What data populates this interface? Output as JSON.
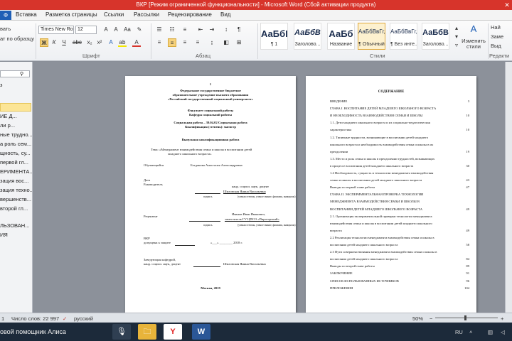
{
  "titlebar": {
    "title": "ВКР [Режим ограниченной функциональности] - Microsoft Word (Сбой активации продукта)",
    "close": "✕",
    "bg": "#d7342b"
  },
  "tabs": {
    "file": "Ф",
    "items": [
      "Вставка",
      "Разметка страницы",
      "Ссылки",
      "Рассылки",
      "Рецензирование",
      "Вид"
    ]
  },
  "ribbon": {
    "clipboard": {
      "label1": "вать",
      "label2": "ат по образцу"
    },
    "font": {
      "name": "Times New Ro",
      "size": "12",
      "group": "Шрифт"
    },
    "paragraph": {
      "group": "Абзац"
    },
    "styles": [
      {
        "sample": "АаБбI",
        "name": "¶ 1"
      },
      {
        "sample": "АаБбВ",
        "name": "Заголово..."
      },
      {
        "sample": "АаБб",
        "name": "Название"
      },
      {
        "sample": "АаБбВвГг,",
        "name": "¶ Обычный"
      },
      {
        "sample": "АаБбВвГг,",
        "name": "¶ Без инте..."
      },
      {
        "sample": "АаБбВ",
        "name": "Заголово..."
      }
    ],
    "change_styles": "Изменить стили",
    "right_items": [
      "Най",
      "Заме",
      "Выд"
    ],
    "editing_group": "Редакти",
    "styles_group": "Стили"
  },
  "navpane": {
    "items": [
      "з",
      "",
      "ИЕ Д...",
      "ли р...",
      "ные трудно...",
      "а роль сем...",
      "щность, су...",
      "первой гл...",
      "ЕРИМЕНТА...",
      "зация вос...",
      "зация техно...",
      "вершенств...",
      "второй гл...",
      "ЛЬЗОВАН...",
      "ИЯ"
    ]
  },
  "page1": {
    "num": "1",
    "org": [
      "Федеральное государственное бюджетное",
      "образовательное учреждение высшего образования",
      "«Российский государственный социальный университет»"
    ],
    "faculty": [
      "Факультет социальной работы",
      "Кафедра социальной работы"
    ],
    "spec": [
      "Социальная работа – 39.04.02 Социальная работа",
      "Квалификация (степень): магистр"
    ],
    "doc_title": "Выпускная квалификационная работа",
    "topic": [
      "Тема: «Менеджмент взаимодействия семьи и школы в воспитании детей",
      "младшего школьного возраста»"
    ],
    "student_label": "Обучающийся",
    "student_name": "Богданова Анастасия Александровна",
    "supervisor_label1": "Дата",
    "supervisor_label2": "Руководитель",
    "supervisor_title": "канд. социол. наук, доцент",
    "supervisor_name": "Шиловская Янина Васильевна",
    "sign_caption": "подпись",
    "sign_hint": "(ученая степень, ученое звание, фамилия, инициалы)",
    "reviewer_label": "Рецензент",
    "reviewer_name": "Иванов Иван Иванович,",
    "reviewer_org": "заместитель ГУ ЦПСО «Пирогорский»",
    "vkr_label": "ВКР",
    "admit": "допущена к защите",
    "admit_date": "«___» ________ 2018 г.",
    "head_label": "Заведующая кафедрой,",
    "head_title": "канд. социол. наук, доцент",
    "head_name": "Шиловская Янина Васильевна",
    "city_year": "Москва, 2019"
  },
  "page2": {
    "heading": "СОДЕРЖАНИЕ",
    "toc": [
      {
        "t": "ВВЕДЕНИЕ",
        "p": "3"
      },
      {
        "t": "ГЛАВА I. ВОСПИТАНИЕ ДЕТЕЙ МЛАДШЕГО ШКОЛЬНОГО ВОЗРАСТА",
        "p": ""
      },
      {
        "t": "И НЕОБХОДИМОСТЬ ВЗАИМОДЕЙСТВИЯ СЕМЬИ И ШКОЛЫ",
        "p": "10"
      },
      {
        "t": "1.1.   Дети младшего школьного возраста и их социально-педагогическая",
        "p": ""
      },
      {
        "t": "характеристика",
        "p": "10"
      },
      {
        "t": "1.2.   Типичные трудности, возникающие в воспитании детей младшего",
        "p": ""
      },
      {
        "t": "школьного возраста и необходимость взаимодействия семьи и школы в их",
        "p": ""
      },
      {
        "t": "преодолении",
        "p": "19"
      },
      {
        "t": "1.3.   Место и роль семьи и школы в преодолении трудностей, возникающих",
        "p": ""
      },
      {
        "t": "в процессе воспитания детей младшего школьного возраста",
        "p": "30"
      },
      {
        "t": "1.4 Необходимость, сущность и технологии менеджмента взаимодействия",
        "p": ""
      },
      {
        "t": "семьи и школы в воспитании детей младшего школьного возраста",
        "p": "43"
      },
      {
        "t": "Выводы по первой главе работы",
        "p": "47"
      },
      {
        "t": "ГЛАВА II. ЭКСПЕРИМЕНТАЛЬНАЯ ПРОВЕРКА ТЕХНОЛОГИИ",
        "p": ""
      },
      {
        "t": "МЕНЕДЖМЕНТА ВЗАИМОДЕЙСТВИЯ СЕМЬИ И ШКОЛЫ В",
        "p": ""
      },
      {
        "t": "ВОСПИТАНИИ ДЕТЕЙ МЛАДШЕГО ШКОЛЬНОГО ВОЗРАСТА",
        "p": "49"
      },
      {
        "t": "2.1.   Организация экспериментальной проверки технологии менеджмента",
        "p": ""
      },
      {
        "t": "взаимодействия семьи и школы в воспитании детей младшего школьного",
        "p": ""
      },
      {
        "t": "возраста",
        "p": "49"
      },
      {
        "t": "2.2 Реализация технологии менеджмента взаимодействия семьи и школы в",
        "p": ""
      },
      {
        "t": "воспитании детей младшего школьного возраста",
        "p": "58"
      },
      {
        "t": "2.3 Пути совершенствования менеджмента взаимодействия семьи и школы в",
        "p": ""
      },
      {
        "t": "воспитании детей младшего школьного возраста",
        "p": "84"
      },
      {
        "t": "Выводы по второй главе работы",
        "p": "89"
      },
      {
        "t": "ЗАКЛЮЧЕНИЕ",
        "p": "91"
      },
      {
        "t": "СПИСОК ИСПОЛЬЗОВАННЫХ ИСТОЧНИКОВ",
        "p": "96"
      },
      {
        "t": "ПРИЛОЖЕНИЯ",
        "p": "104"
      }
    ]
  },
  "statusbar": {
    "words": "Число слов: 22 997",
    "lang": "русский",
    "zoom": "50%"
  },
  "taskbar": {
    "assistant": "овой помощник Алиса",
    "lang": "RU"
  }
}
